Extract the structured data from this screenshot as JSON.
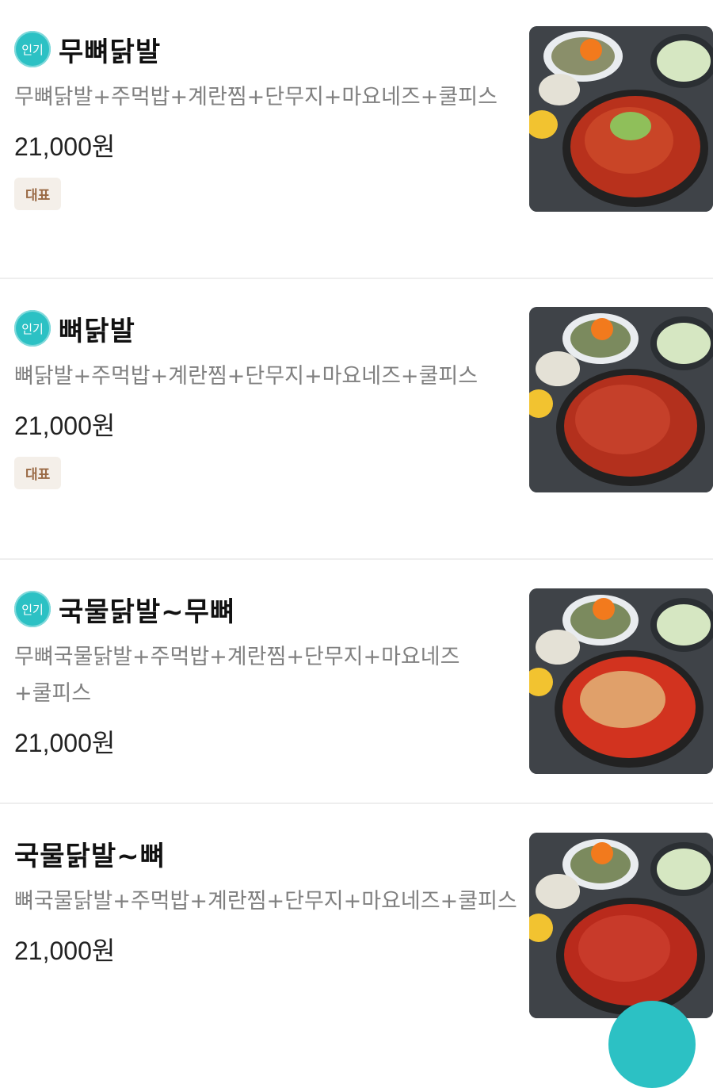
{
  "menu": {
    "items": [
      {
        "name": "무뼈닭발",
        "popular": "인기",
        "desc": "무뼈닭발+주먹밥+계란찜+단무지+마요네즈+쿨피스",
        "price": "21,000원",
        "tag": "대표"
      },
      {
        "name": "뼈닭발",
        "popular": "인기",
        "desc": "뼈닭발+주먹밥+계란찜+단무지+마요네즈+쿨피스",
        "price": "21,000원",
        "tag": "대표"
      },
      {
        "name": "국물닭발~무뼈",
        "popular": "인기",
        "desc": "무뼈국물닭발+주먹밥+계란찜+단무지+마요네즈+쿨피스",
        "price": "21,000원"
      },
      {
        "name": "국물닭발~뼈",
        "desc": "뼈국물닭발+주먹밥+계란찜+단무지+마요네즈+쿨피스",
        "price": "21,000원"
      }
    ]
  }
}
